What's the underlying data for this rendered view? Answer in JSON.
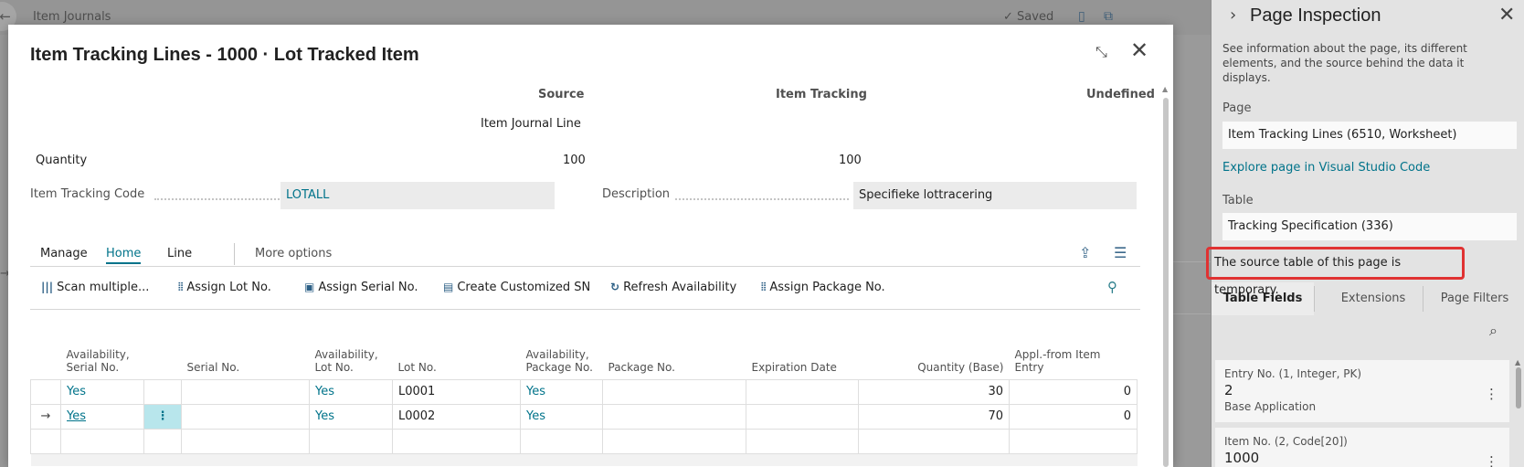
{
  "background": {
    "title": "Item Journals",
    "saved": "Saved",
    "back_icon": "arrow-left-icon",
    "bookmark_icon": "bookmark-icon",
    "popout_icon": "popout-icon"
  },
  "dialog": {
    "title": "Item Tracking Lines - 1000 · Lot Tracked Item",
    "collapse_icon": "collapse-icon",
    "close_icon": "close-icon",
    "summary": {
      "headers": [
        "Source",
        "Item Tracking",
        "Undefined"
      ],
      "source_value": "Item Journal Line",
      "quantity_label": "Quantity",
      "quantity_source": "100",
      "quantity_tracking": "100"
    },
    "fields": {
      "item_tracking_code_label": "Item Tracking Code",
      "item_tracking_code_value": "LOTALL",
      "description_label": "Description",
      "description_value": "Specifieke lottracering"
    },
    "tabs": {
      "manage": "Manage",
      "home": "Home",
      "line": "Line",
      "more": "More options"
    },
    "actions": {
      "scan_multiple": "Scan multiple...",
      "assign_lot": "Assign Lot No.",
      "assign_serial": "Assign Serial No.",
      "create_sn": "Create Customized SN",
      "refresh": "Refresh Availability",
      "assign_package": "Assign Package No."
    },
    "grid": {
      "columns": {
        "avail_serial": "Availability, Serial No.",
        "serial": "Serial No.",
        "avail_lot": "Availability, Lot No.",
        "lot": "Lot No.",
        "avail_package": "Availability, Package No.",
        "package": "Package No.",
        "expiration": "Expiration Date",
        "qty_base": "Quantity (Base)",
        "appl_from": "Appl.-from Item Entry"
      },
      "rows": [
        {
          "avail_serial": "Yes",
          "serial": "",
          "avail_lot": "Yes",
          "lot": "L0001",
          "avail_package": "Yes",
          "package": "",
          "expiration": "",
          "qty_base": "30",
          "appl_from": "0"
        },
        {
          "avail_serial": "Yes",
          "serial": "",
          "avail_lot": "Yes",
          "lot": "L0002",
          "avail_package": "Yes",
          "package": "",
          "expiration": "",
          "qty_base": "70",
          "appl_from": "0"
        }
      ]
    }
  },
  "panel": {
    "title": "Page Inspection",
    "description": "See information about the page, its different elements, and the source behind the data it displays.",
    "page_label": "Page",
    "page_value": "Item Tracking Lines (6510, Worksheet)",
    "explore_link": "Explore page in Visual Studio Code",
    "table_label": "Table",
    "table_value": "Tracking Specification (336)",
    "temporary_notice": "The source table of this page is temporary.",
    "tabs": [
      "Table Fields",
      "Extensions",
      "Page Filters"
    ],
    "cards": [
      {
        "label": "Entry No. (1, Integer, PK)",
        "value": "2",
        "source": "Base Application"
      },
      {
        "label": "Item No. (2, Code[20])",
        "value": "1000",
        "source": ""
      }
    ]
  }
}
